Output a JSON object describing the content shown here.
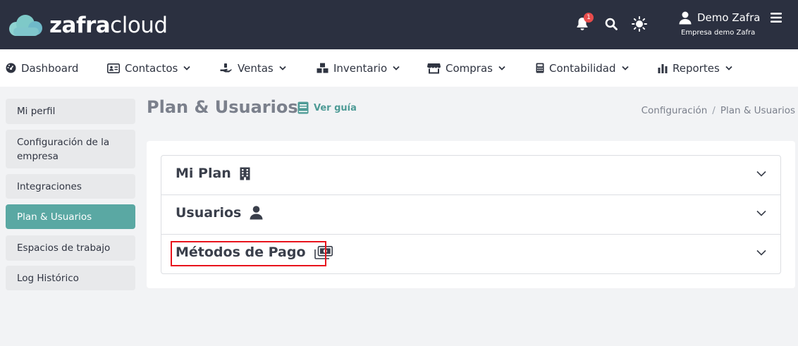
{
  "header": {
    "logo_light": "zafra",
    "logo_regular": "cloud",
    "notification_count": "1",
    "user_name": "Demo Zafra",
    "company": "Empresa demo Zafra",
    "icons": [
      "cloud-logo-icon",
      "bell-icon",
      "search-icon",
      "sun-icon",
      "user-icon",
      "hamburger-menu-icon"
    ]
  },
  "nav": {
    "items": [
      {
        "label": "Dashboard",
        "icon": "gauge-icon",
        "dropdown": false
      },
      {
        "label": "Contactos",
        "icon": "contact-card-icon",
        "dropdown": true
      },
      {
        "label": "Ventas",
        "icon": "hand-money-icon",
        "dropdown": true
      },
      {
        "label": "Inventario",
        "icon": "boxes-icon",
        "dropdown": true
      },
      {
        "label": "Compras",
        "icon": "store-icon",
        "dropdown": true
      },
      {
        "label": "Contabilidad",
        "icon": "calculator-icon",
        "dropdown": true
      },
      {
        "label": "Reportes",
        "icon": "bar-chart-icon",
        "dropdown": true
      }
    ]
  },
  "sidebar": {
    "items": [
      {
        "label": "Mi perfil",
        "active": false
      },
      {
        "label": "Configuración de la empresa",
        "active": false
      },
      {
        "label": "Integraciones",
        "active": false
      },
      {
        "label": "Plan & Usuarios",
        "active": true
      },
      {
        "label": "Espacios de trabajo",
        "active": false
      },
      {
        "label": "Log Histórico",
        "active": false
      }
    ]
  },
  "main": {
    "title": "Plan & Usuarios",
    "guide_label": "Ver guía",
    "breadcrumb": [
      "Configuración",
      "Plan & Usuarios"
    ],
    "sections": [
      {
        "label": "Mi Plan",
        "icon": "building-icon"
      },
      {
        "label": "Usuarios",
        "icon": "user-icon"
      },
      {
        "label": "Métodos de Pago",
        "icon": "money-bills-icon"
      }
    ]
  },
  "colors": {
    "header_bg": "#2b3040",
    "accent": "#5aa8a3",
    "highlight": "#e8141c",
    "badge": "#e74c4c"
  }
}
